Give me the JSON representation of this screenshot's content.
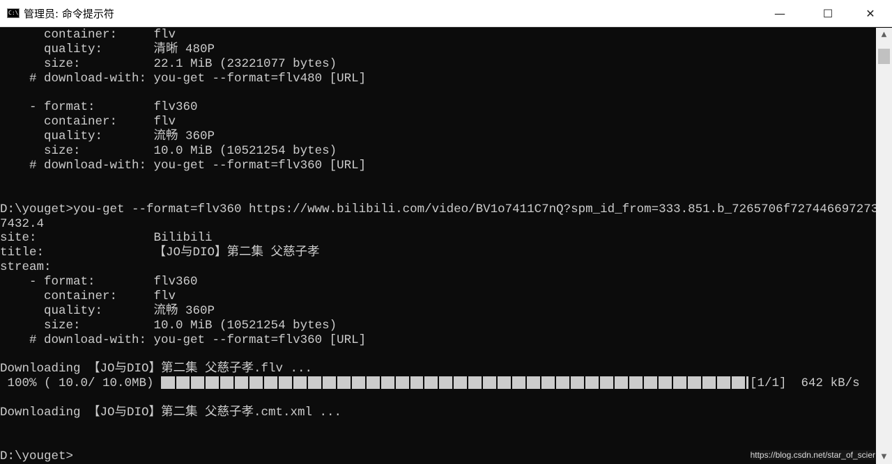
{
  "window": {
    "title": "管理员: 命令提示符",
    "icon": "cmd-icon",
    "icon_text": "C:\\",
    "minimize": "—",
    "maximize": "☐",
    "close": "✕"
  },
  "console": {
    "lines": [
      "      container:     flv",
      "      quality:       清晰 480P",
      "      size:          22.1 MiB (23221077 bytes)",
      "    # download-with: you-get --format=flv480 [URL]",
      "",
      "    - format:        flv360",
      "      container:     flv",
      "      quality:       流畅 360P",
      "      size:          10.0 MiB (10521254 bytes)",
      "    # download-with: you-get --format=flv360 [URL]",
      "",
      "",
      "D:\\youget>you-get --format=flv360 https://www.bilibili.com/video/BV1o7411C7nQ?spm_id_from=333.851.b_7265706f727446697273",
      "7432.4",
      "site:                Bilibili",
      "title:               【JO与DIO】第二集 父慈子孝",
      "stream:",
      "    - format:        flv360",
      "      container:     flv",
      "      quality:       流畅 360P",
      "      size:          10.0 MiB (10521254 bytes)",
      "    # download-with: you-get --format=flv360 [URL]",
      "",
      "Downloading 【JO与DIO】第二集 父慈子孝.flv ..."
    ],
    "progress": {
      "prefix": " 100% ( 10.0/ 10.0MB) ",
      "percent": 100,
      "suffix": "[1/1]  642 kB/s"
    },
    "lines_after": [
      "",
      "Downloading 【JO与DIO】第二集 父慈子孝.cmt.xml ...",
      "",
      "",
      "D:\\youget>"
    ]
  },
  "colors": {
    "background": "#0c0c0c",
    "text": "#cccccc"
  },
  "watermark": "https://blog.csdn.net/star_of_scier",
  "scrollbar": {
    "up": "▲",
    "down": "▼"
  }
}
